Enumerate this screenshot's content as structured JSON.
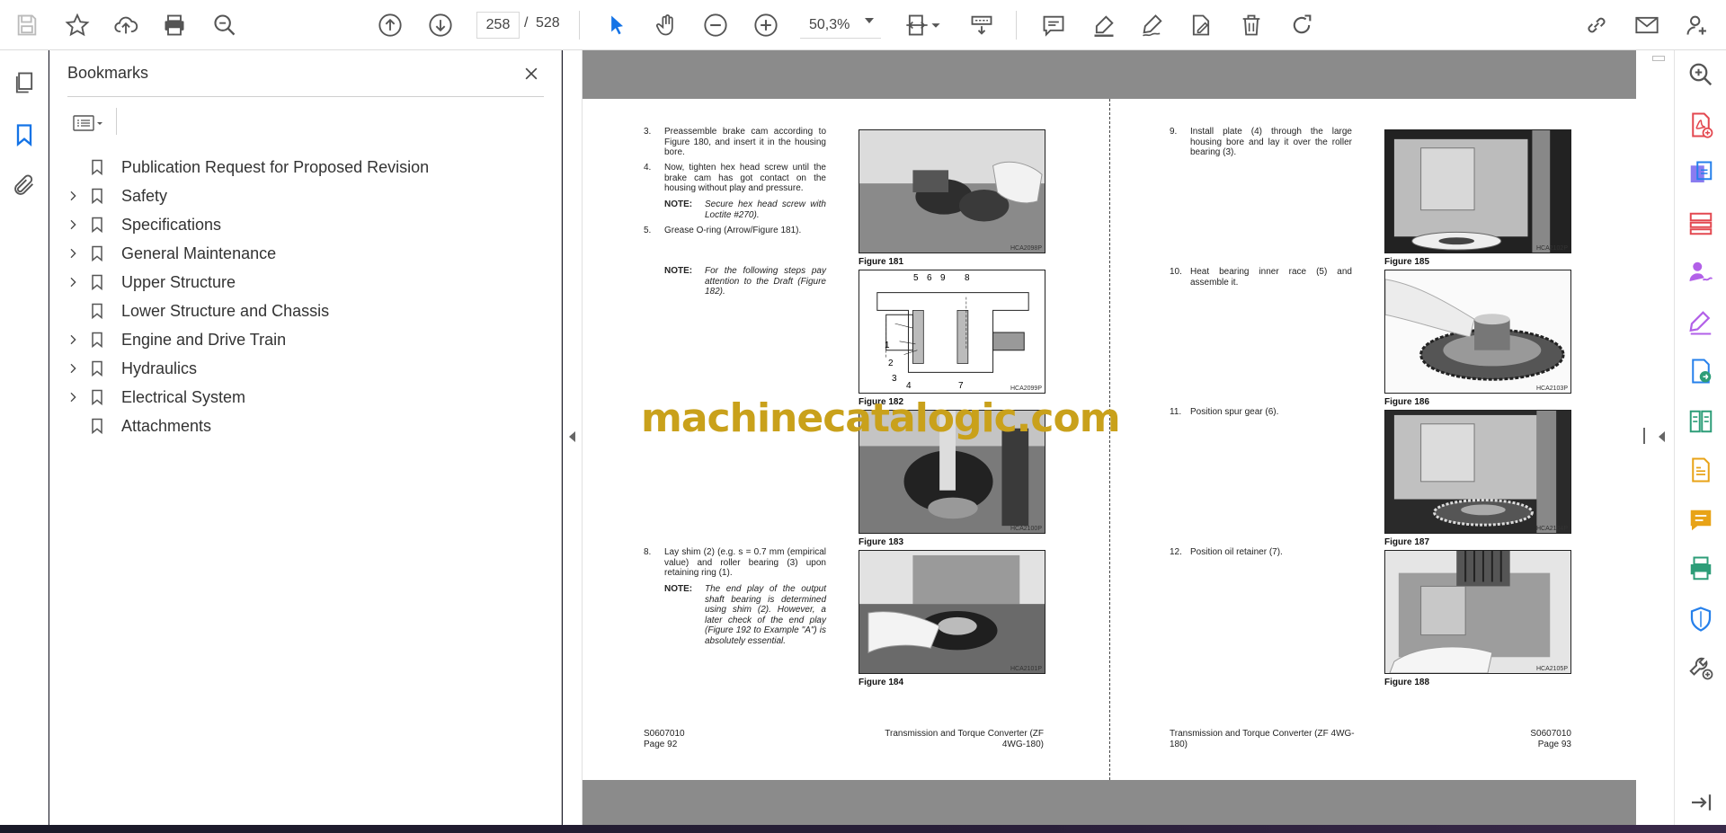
{
  "toolbar": {
    "page_current": "258",
    "page_separator": "/",
    "page_total": "528",
    "zoom": "50,3%"
  },
  "bookmarks": {
    "title": "Bookmarks",
    "items": [
      {
        "label": "Publication Request for Proposed Revision",
        "expandable": false
      },
      {
        "label": "Safety",
        "expandable": true
      },
      {
        "label": "Specifications",
        "expandable": true
      },
      {
        "label": "General Maintenance",
        "expandable": true
      },
      {
        "label": "Upper Structure",
        "expandable": true
      },
      {
        "label": "Lower Structure and Chassis",
        "expandable": false
      },
      {
        "label": "Engine and Drive Train",
        "expandable": true
      },
      {
        "label": "Hydraulics",
        "expandable": true
      },
      {
        "label": "Electrical System",
        "expandable": true
      },
      {
        "label": "Attachments",
        "expandable": false
      }
    ]
  },
  "document": {
    "left_page": {
      "steps": [
        {
          "num": "3.",
          "text": "Preassemble brake cam according to Figure 180, and insert it in the housing bore."
        },
        {
          "num": "4.",
          "text": "Now, tighten hex head screw until the brake cam has got contact on the housing without play and pressure."
        },
        {
          "num": "5.",
          "text": "Grease O-ring (Arrow/Figure 181)."
        },
        {
          "num": "8.",
          "text": "Lay shim (2) (e.g. s = 0.7 mm (empirical value) and roller bearing (3) upon retaining ring (1)."
        }
      ],
      "notes": [
        {
          "label": "NOTE:",
          "text": "Secure hex head screw with Loctite #270)."
        },
        {
          "label": "NOTE:",
          "text": "For the following steps pay attention to the Draft (Figure 182)."
        },
        {
          "label": "NOTE:",
          "text": "The end play of the output shaft bearing is determined using shim (2). However, a later check of the end play (Figure 192 to Example \"A\") is absolutely essential."
        }
      ],
      "figures": [
        {
          "caption": "Figure 181",
          "code": "HCA2098P"
        },
        {
          "caption": "Figure 182",
          "code": "HCA2099P"
        },
        {
          "caption": "Figure 183",
          "code": "HCA2100P"
        },
        {
          "caption": "Figure 184",
          "code": "HCA2101P"
        }
      ],
      "diagram_labels": [
        "5",
        "6",
        "9",
        "8",
        "1",
        "2",
        "3",
        "4",
        "7"
      ],
      "footer_left_line1": "S0607010",
      "footer_left_line2": "Page 92",
      "footer_right": "Transmission and Torque Converter (ZF 4WG-180)"
    },
    "right_page": {
      "steps": [
        {
          "num": "9.",
          "text": "Install plate (4) through the large housing bore and lay it over the roller bearing (3)."
        },
        {
          "num": "10.",
          "text": "Heat bearing inner race (5) and assemble it."
        },
        {
          "num": "11.",
          "text": "Position spur gear (6)."
        },
        {
          "num": "12.",
          "text": "Position oil retainer (7)."
        }
      ],
      "figures": [
        {
          "caption": "Figure 185",
          "code": "HCA2102P"
        },
        {
          "caption": "Figure 186",
          "code": "HCA2103P"
        },
        {
          "caption": "Figure 187",
          "code": "HCA2104P"
        },
        {
          "caption": "Figure 188",
          "code": "HCA2105P"
        }
      ],
      "footer_left": "Transmission and Torque Converter (ZF 4WG-180)",
      "footer_right_line1": "S0607010",
      "footer_right_line2": "Page 93"
    },
    "watermark": "machinecatalogic.com"
  }
}
